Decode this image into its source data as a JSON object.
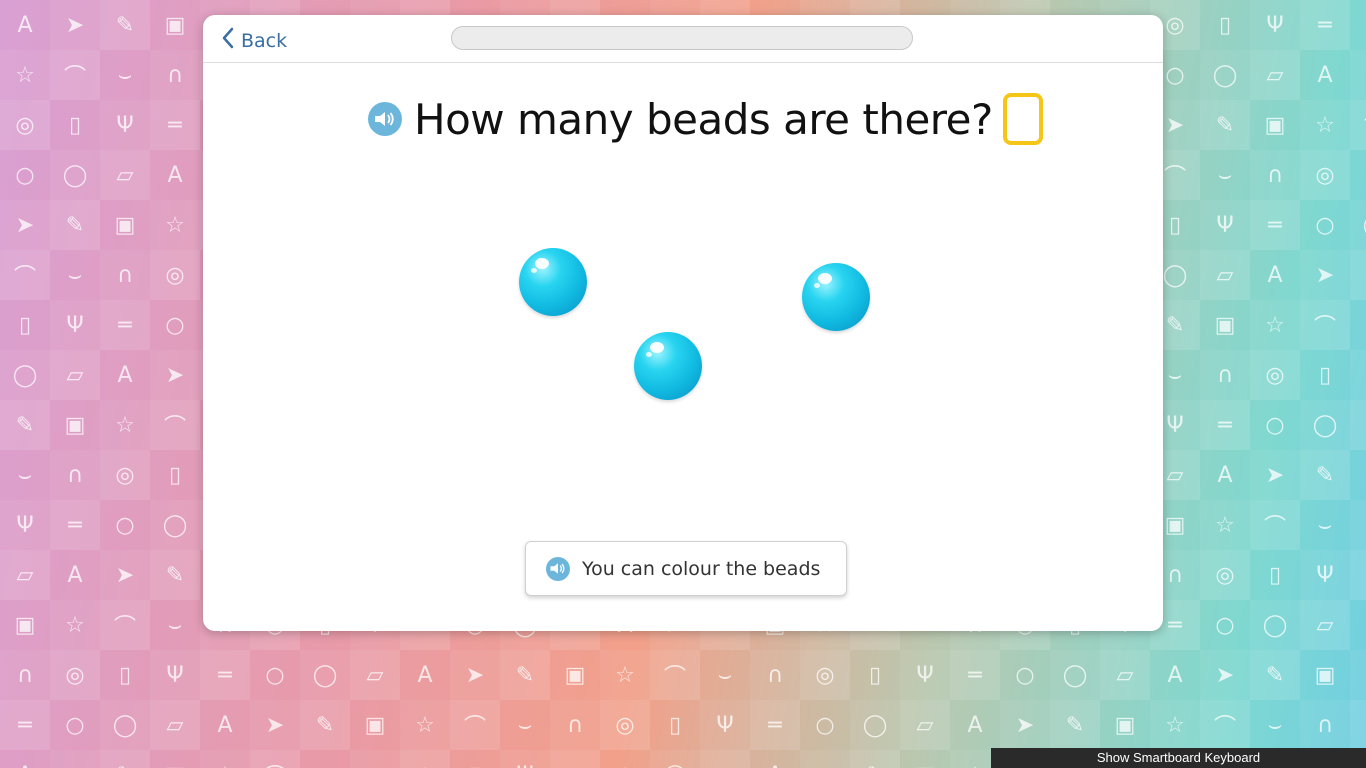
{
  "header": {
    "back_label": "Back",
    "progress_fraction": 0
  },
  "question": {
    "text": "How many beads are there?",
    "answer_value": "",
    "speaker_icon": "speaker-icon"
  },
  "beads": {
    "count_shown": 3,
    "color": "#10b9e0"
  },
  "hint": {
    "label": "You can colour the beads",
    "speaker_icon": "speaker-icon"
  },
  "footer": {
    "keyboard_toggle_label": "Show Smartboard Keyboard"
  },
  "background": {
    "icons": [
      "letter-a-icon",
      "paper-plane-icon",
      "pencil-icon",
      "briefcase-icon",
      "star-icon",
      "sneaker-icon",
      "wifi-icon",
      "headphones-icon",
      "globe-icon",
      "ipod-icon",
      "slingshot-icon",
      "skateboard-icon",
      "apple-icon",
      "circle-icon",
      "book-icon"
    ]
  },
  "colors": {
    "answer_border": "#f5c518",
    "back_link": "#3a6ea5",
    "speaker": "#6cb6dc"
  }
}
